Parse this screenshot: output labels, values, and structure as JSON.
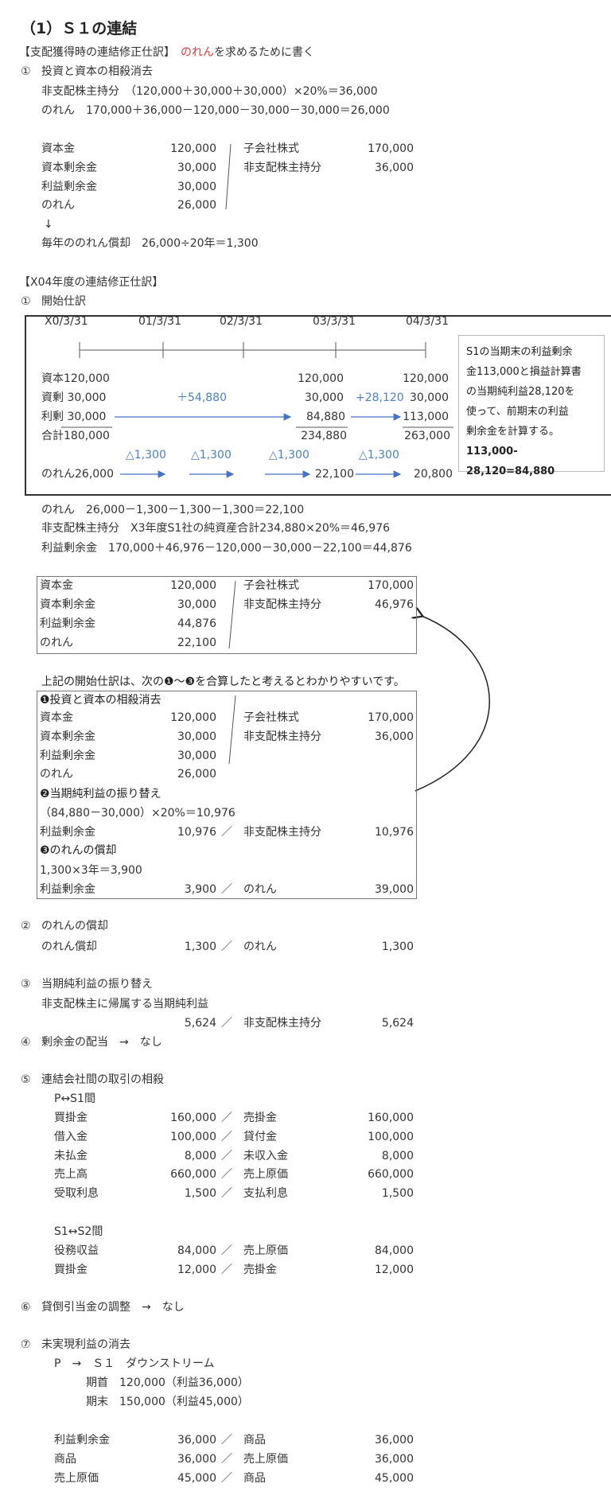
{
  "title": "（1）Ｓ１の連結",
  "acq": {
    "heading": "【支配獲得時の連結修正仕訳】",
    "note_red": "のれん",
    "note_rest": "を求めるために書く",
    "step1": "①",
    "step1_label": "投資と資本の相殺消去",
    "calc_nci": "非支配株主持分　（120,000＋30,000＋30,000）×20%＝36,000",
    "calc_gw": "のれん　170,000＋36,000－120,000－30,000－30,000＝26,000",
    "debits": [
      {
        "account": "資本金",
        "amount": "120,000"
      },
      {
        "account": "資本剰余金",
        "amount": "30,000"
      },
      {
        "account": "利益剰余金",
        "amount": "30,000"
      },
      {
        "account": "のれん",
        "amount": "26,000"
      }
    ],
    "credits": [
      {
        "account": "子会社株式",
        "amount": "170,000"
      },
      {
        "account": "非支配株主持分",
        "amount": "36,000"
      }
    ],
    "down_arrow": "↓",
    "amort": "毎年ののれん償却　26,000÷20年＝1,300"
  },
  "x04": {
    "heading": "【X04年度の連結修正仕訳】",
    "step1": "①",
    "step1_label": "開始仕訳",
    "timeline": {
      "dates": [
        "X0/3/31",
        "01/3/31",
        "02/3/31",
        "03/3/31",
        "04/3/31"
      ],
      "row_capital": "資本120,000",
      "row_capsur": "資剰 30,000",
      "row_re": "利剰 30,000",
      "row_total": "合計180,000",
      "cap_03": "120,000",
      "cap_04": "120,000",
      "capsur_03": "30,000",
      "capsur_04": "30,000",
      "re_03": "84,880",
      "re_04": "113,000",
      "total_03": "234,880",
      "total_04": "263,000",
      "inc1": "＋54,880",
      "inc2": "+28,120",
      "amort_labels": [
        "△1,300",
        "△1,300",
        "△1,300",
        "△1,300"
      ],
      "gw_start": "のれん26,000",
      "gw_03": "22,100",
      "gw_04": "20,800",
      "note_lines": [
        "S1の当期末の利益剰余",
        "金113,000と損益計算書",
        "の当期純利益28,120を",
        "使って、前期末の利益",
        "剰余金を計算する。"
      ],
      "note_formula": "113,000-28,120=84,880"
    },
    "calc_gw": "のれん　26,000－1,300－1,300－1,300＝22,100",
    "calc_nci": "非支配株主持分　X3年度S1社の純資産合計234,880×20%＝46,976",
    "calc_re": "利益剰余金　170,000＋46,976－120,000－30,000－22,100＝44,876",
    "opening": {
      "debits": [
        {
          "account": "資本金",
          "amount": "120,000"
        },
        {
          "account": "資本剰余金",
          "amount": "30,000"
        },
        {
          "account": "利益剰余金",
          "amount": "44,876"
        },
        {
          "account": "のれん",
          "amount": "22,100"
        }
      ],
      "credits": [
        {
          "account": "子会社株式",
          "amount": "170,000"
        },
        {
          "account": "非支配株主持分",
          "amount": "46,976"
        }
      ]
    },
    "explain": "上記の開始仕訳は、次の❶～❸を合算したと考えるとわかりやすいです。",
    "b1": {
      "heading": "❶投資と資本の相殺消去",
      "debits": [
        {
          "account": "資本金",
          "amount": "120,000"
        },
        {
          "account": "資本剰余金",
          "amount": "30,000"
        },
        {
          "account": "利益剰余金",
          "amount": "30,000"
        },
        {
          "account": "のれん",
          "amount": "26,000"
        }
      ],
      "credits": [
        {
          "account": "子会社株式",
          "amount": "170,000"
        },
        {
          "account": "非支配株主持分",
          "amount": "36,000"
        }
      ]
    },
    "b2": {
      "heading": "❷当期純利益の振り替え",
      "calc": "（84,880－30,000）×20%＝10,976",
      "dr": "利益剰余金",
      "dr_amt": "10,976",
      "slash": "／",
      "cr": "非支配株主持分",
      "cr_amt": "10,976"
    },
    "b3": {
      "heading": "❸のれんの償却",
      "calc": "1,300×3年＝3,900",
      "dr": "利益剰余金",
      "dr_amt": "3,900",
      "slash": "／",
      "cr": "のれん",
      "cr_amt": "39,000"
    },
    "s2": {
      "num": "②",
      "label": "のれんの償却",
      "dr": "のれん償却",
      "dr_amt": "1,300",
      "slash": "／",
      "cr": "のれん",
      "cr_amt": "1,300"
    },
    "s3": {
      "num": "③",
      "label": "当期純利益の振り替え",
      "sub": "非支配株主に帰属する当期純利益",
      "dr_amt": "5,624",
      "slash": "／",
      "cr": "非支配株主持分",
      "cr_amt": "5,624"
    },
    "s4": {
      "num": "④",
      "label": "剰余金の配当　→　なし"
    },
    "s5": {
      "num": "⑤",
      "label": "連結会社間の取引の相殺",
      "g1": "P↔S1間",
      "g1_rows": [
        {
          "dr": "買掛金",
          "dr_amt": "160,000",
          "cr": "売掛金",
          "cr_amt": "160,000"
        },
        {
          "dr": "借入金",
          "dr_amt": "100,000",
          "cr": "貸付金",
          "cr_amt": "100,000"
        },
        {
          "dr": "未払金",
          "dr_amt": "8,000",
          "cr": "未収入金",
          "cr_amt": "8,000"
        },
        {
          "dr": "売上高",
          "dr_amt": "660,000",
          "cr": "売上原価",
          "cr_amt": "660,000"
        },
        {
          "dr": "受取利息",
          "dr_amt": "1,500",
          "cr": "支払利息",
          "cr_amt": "1,500"
        }
      ],
      "g2": "S1↔S2間",
      "g2_rows": [
        {
          "dr": "役務収益",
          "dr_amt": "84,000",
          "cr": "売上原価",
          "cr_amt": "84,000"
        },
        {
          "dr": "買掛金",
          "dr_amt": "12,000",
          "cr": "売掛金",
          "cr_amt": "12,000"
        }
      ],
      "slash": "／"
    },
    "s6": {
      "num": "⑥",
      "label": "貸倒引当金の調整　→　なし"
    },
    "s7": {
      "num": "⑦",
      "label": "未実現利益の消去",
      "flow": "P　→　Ｓ１　ダウンストリーム",
      "begin": "期首　120,000（利益36,000）",
      "end": "期末　150,000（利益45,000）",
      "rows": [
        {
          "dr": "利益剰余金",
          "dr_amt": "36,000",
          "cr": "商品",
          "cr_amt": "36,000"
        },
        {
          "dr": "商品",
          "dr_amt": "36,000",
          "cr": "売上原価",
          "cr_amt": "36,000"
        },
        {
          "dr": "売上原価",
          "dr_amt": "45,000",
          "cr": "商品",
          "cr_amt": "45,000"
        }
      ],
      "slash": "／"
    }
  }
}
